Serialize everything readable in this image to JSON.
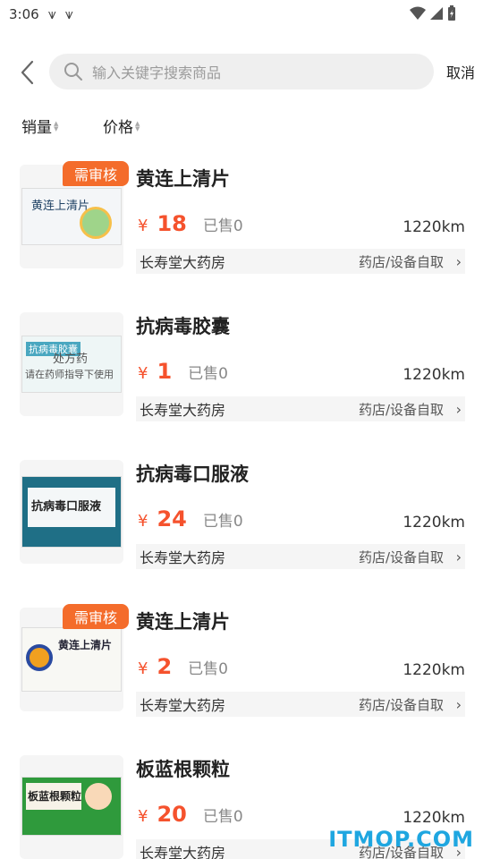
{
  "status_bar": {
    "time": "3:06",
    "left_icons": [
      "download-check-icon",
      "download-check-icon"
    ],
    "right_icons": [
      "wifi-icon",
      "signal-icon",
      "battery-icon"
    ]
  },
  "search": {
    "placeholder": "输入关键字搜索商品",
    "cancel_label": "取消",
    "back_icon": "back-arrow-icon",
    "search_icon": "search-icon"
  },
  "sort": [
    {
      "label": "销量"
    },
    {
      "label": "价格"
    }
  ],
  "colors": {
    "price": "#f5522d",
    "badge": "#f46c2b",
    "watermark": "#1ea6e0"
  },
  "products": [
    {
      "badge": "需审核",
      "title": "黄连上清片",
      "price_symbol": "¥",
      "price": "18",
      "sold": "已售0",
      "distance": "1220km",
      "store": "长寿堂大药房",
      "pickup": "药店/设备自取",
      "thumb_text": "黄连上清片"
    },
    {
      "badge": "",
      "title": "抗病毒胶囊",
      "price_symbol": "¥",
      "price": "1",
      "sold": "已售0",
      "distance": "1220km",
      "store": "长寿堂大药房",
      "pickup": "药店/设备自取",
      "thumb_text": "抗病毒胶囊",
      "thumb_overlay_1": "处方药",
      "thumb_overlay_2": "请在药师指导下使用"
    },
    {
      "badge": "",
      "title": "抗病毒口服液",
      "price_symbol": "¥",
      "price": "24",
      "sold": "已售0",
      "distance": "1220km",
      "store": "长寿堂大药房",
      "pickup": "药店/设备自取",
      "thumb_text": "抗病毒口服液"
    },
    {
      "badge": "需审核",
      "title": "黄连上清片",
      "price_symbol": "¥",
      "price": "2",
      "sold": "已售0",
      "distance": "1220km",
      "store": "长寿堂大药房",
      "pickup": "药店/设备自取",
      "thumb_text": "黄连上清片"
    },
    {
      "badge": "",
      "title": "板蓝根颗粒",
      "price_symbol": "¥",
      "price": "20",
      "sold": "已售0",
      "distance": "1220km",
      "store": "长寿堂大药房",
      "pickup": "药店/设备自取",
      "thumb_text": "板蓝根颗粒"
    }
  ],
  "watermark": "ITMOP.COM"
}
